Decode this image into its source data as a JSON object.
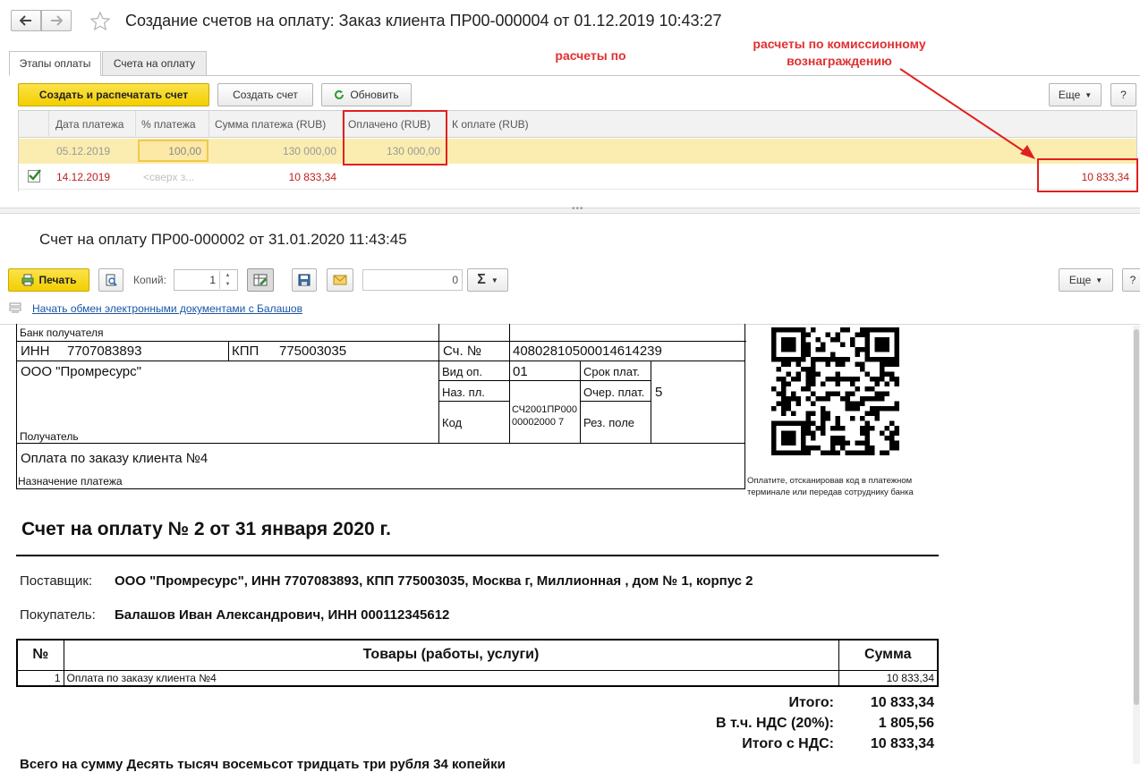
{
  "window": {
    "title": "Создание счетов на оплату: Заказ клиента ПР00-000004 от 01.12.2019 10:43:27"
  },
  "tabs": [
    {
      "label": "Этапы оплаты",
      "active": true
    },
    {
      "label": "Счета на оплату",
      "active": false
    }
  ],
  "annotations": {
    "a1": "расчеты по",
    "a2_line1": "расчеты по комиссионному",
    "a2_line2": "вознаграждению",
    "color": "#e03030"
  },
  "toolbar": {
    "create_print": "Создать и распечатать счет",
    "create": "Создать счет",
    "refresh": "Обновить",
    "more": "Еще",
    "help": "?"
  },
  "grid": {
    "columns": [
      "Дата платежа",
      "% платежа",
      "Сумма платежа (RUB)",
      "Оплачено (RUB)",
      "К оплате (RUB)"
    ],
    "rows": [
      {
        "checked": false,
        "date": "05.12.2019",
        "percent": "100,00",
        "amount": "130 000,00",
        "paid": "130 000,00",
        "to_pay": ""
      },
      {
        "checked": true,
        "date": "14.12.2019",
        "percent": "<сверх з...",
        "amount": "10 833,34",
        "paid": "",
        "to_pay": "10 833,34"
      }
    ]
  },
  "doc": {
    "title": "Счет на оплату ПР00-000002 от 31.01.2020 11:43:45",
    "print": "Печать",
    "copies_label": "Копий:",
    "copies_value": "1",
    "sum_value": "0",
    "sum_symbol": "Σ",
    "more": "Еще",
    "help": "?",
    "exchange_link": "Начать обмен электронными документами с Балашов"
  },
  "bank": {
    "bank_receiver": "Банк получателя",
    "inn_label": "ИНН",
    "inn": "7707083893",
    "kpp_label": "КПП",
    "kpp": "775003035",
    "acc_label": "Сч. №",
    "acc": "40802810500014614239",
    "receiver_name": "ООО \"Промресурс\"",
    "receiver_label": "Получатель",
    "vid_op_label": "Вид оп.",
    "vid_op": "01",
    "naz_pl_label": "Наз. пл.",
    "kod_label": "Код",
    "kod": "СЧ2001ПР00000002000 7",
    "srok_label": "Срок плат.",
    "ocher_label": "Очер. плат.",
    "ocher": "5",
    "rez_label": "Рез. поле",
    "purpose": "Оплата по заказу клиента №4",
    "purpose_label": "Назначение платежа",
    "qr_caption": "Оплатите, отсканировав код в платежном терминале или передав сотруднику банка"
  },
  "invoice": {
    "heading": "Счет на оплату № 2 от 31 января 2020 г.",
    "supplier_label": "Поставщик:",
    "supplier": "ООО \"Промресурс\", ИНН 7707083893, КПП 775003035, Москва г, Миллионная , дом № 1, корпус 2",
    "buyer_label": "Покупатель:",
    "buyer": "Балашов Иван Александрович, ИНН 000112345612",
    "table_headers": {
      "num": "№",
      "goods": "Товары (работы, услуги)",
      "sum": "Сумма"
    },
    "items": [
      {
        "num": "1",
        "name": "Оплата по заказу клиента №4",
        "sum": "10 833,34"
      }
    ],
    "total_label": "Итого:",
    "total": "10 833,34",
    "vat_label": "В т.ч. НДС (20%):",
    "vat": "1 805,56",
    "total_vat_label": "Итого с НДС:",
    "total_vat": "10 833,34",
    "sum_in_words": "Всего на сумму Десять тысяч восемьсот тридцать три рубля 34 копейки"
  }
}
